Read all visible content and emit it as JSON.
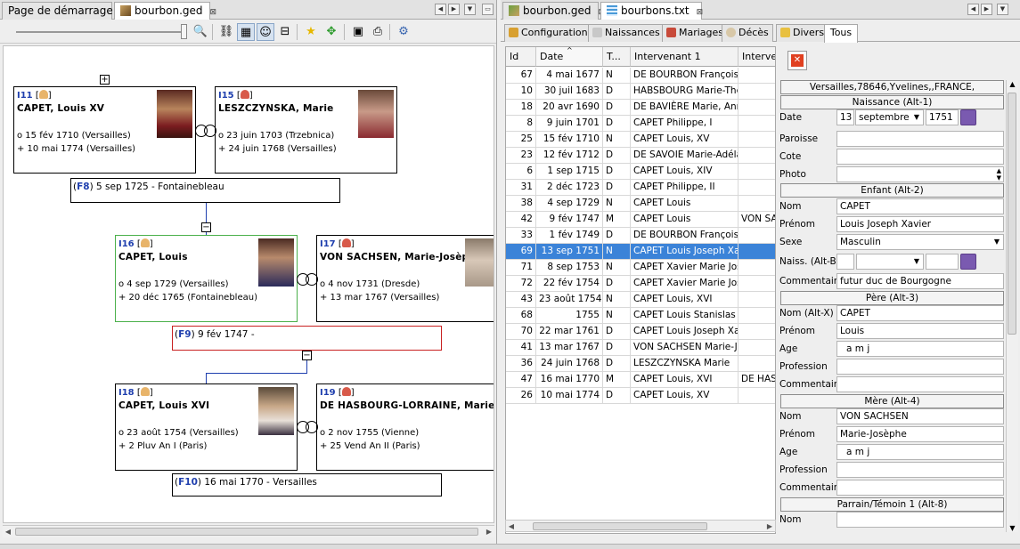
{
  "left": {
    "tabs": [
      {
        "label": "Page de démarrage",
        "close": "⊠"
      },
      {
        "label": "bourbon.ged",
        "close": "⊠"
      }
    ],
    "tree": {
      "individuals": [
        {
          "id": "I11",
          "name": "CAPET, Louis XV",
          "sex": "M",
          "birth": "o 15 fév 1710  (Versailles)",
          "death": "+ 10 mai 1774  (Versailles)"
        },
        {
          "id": "I15",
          "name": "LESZCZYNSKA, Marie",
          "sex": "F",
          "birth": "o 23 juin 1703  (Trzebnica)",
          "death": "+ 24 juin 1768  (Versailles)"
        },
        {
          "id": "I16",
          "name": "CAPET, Louis",
          "sex": "M",
          "birth": "o 4 sep 1729  (Versailles)",
          "death": "+ 20 déc 1765  (Fontainebleau)"
        },
        {
          "id": "I17",
          "name": "VON SACHSEN, Marie-Josèphe",
          "sex": "F",
          "birth": "o 4 nov 1731  (Dresde)",
          "death": "+ 13 mar 1767  (Versailles)"
        },
        {
          "id": "I18",
          "name": "CAPET, Louis XVI",
          "sex": "M",
          "birth": "o 23 août 1754  (Versailles)",
          "death": "+ 2 Pluv An I  (Paris)"
        },
        {
          "id": "I19",
          "name": "DE HASBOURG-LORRAINE, Marie Antoinette",
          "sex": "F",
          "birth": "o 2 nov 1755  (Vienne)",
          "death": "+ 25 Vend An II  (Paris)"
        }
      ],
      "families": [
        {
          "id": "F8",
          "text": ") 5 sep 1725 - Fontainebleau"
        },
        {
          "id": "F9",
          "text": ") 9 fév 1747 -"
        },
        {
          "id": "F10",
          "text": ") 16 mai 1770 - Versailles"
        }
      ],
      "expand_plus": "+",
      "collapse_minus": "−"
    }
  },
  "right": {
    "tabs": [
      {
        "label": "bourbon.ged",
        "close": "⊠"
      },
      {
        "label": "bourbons.txt",
        "close": "⊠"
      }
    ],
    "subtabs": [
      "Configuration",
      "Naissances",
      "Mariages",
      "Décès",
      "Divers",
      "Tous"
    ],
    "table": {
      "columns": [
        "Id",
        "Date",
        "T...",
        "Intervenant 1",
        "Interven"
      ],
      "rows": [
        [
          "67",
          "4 mai 1677",
          "N",
          "DE BOURBON Françoise,",
          ""
        ],
        [
          "10",
          "30 juil 1683",
          "D",
          "HABSBOURG Marie-Thére",
          ""
        ],
        [
          "18",
          "20 avr 1690",
          "D",
          "DE BAVIÈRE Marie, Anne",
          ""
        ],
        [
          "8",
          "9 juin 1701",
          "D",
          "CAPET Philippe, I",
          ""
        ],
        [
          "25",
          "15 fév 1710",
          "N",
          "CAPET Louis, XV",
          ""
        ],
        [
          "23",
          "12 fév 1712",
          "D",
          "DE SAVOIE Marie-Adélaïc",
          ""
        ],
        [
          "6",
          "1 sep 1715",
          "D",
          "CAPET Louis, XIV",
          ""
        ],
        [
          "31",
          "2 déc 1723",
          "D",
          "CAPET Philippe, II",
          ""
        ],
        [
          "38",
          "4 sep 1729",
          "N",
          "CAPET Louis",
          ""
        ],
        [
          "42",
          "9 fév 1747",
          "M",
          "CAPET Louis",
          "VON SAC"
        ],
        [
          "33",
          "1 fév 1749",
          "D",
          "DE BOURBON Françoise,",
          ""
        ],
        [
          "69",
          "13 sep 1751",
          "N",
          "CAPET Louis Joseph Xav",
          ""
        ],
        [
          "71",
          "8 sep 1753",
          "N",
          "CAPET Xavier Marie Jose",
          ""
        ],
        [
          "72",
          "22 fév 1754",
          "D",
          "CAPET Xavier Marie Jose",
          ""
        ],
        [
          "43",
          "23 août 1754",
          "N",
          "CAPET Louis, XVI",
          ""
        ],
        [
          "68",
          "1755",
          "N",
          "CAPET Louis Stanislas Xa",
          ""
        ],
        [
          "70",
          "22 mar 1761",
          "D",
          "CAPET Louis Joseph Xav",
          ""
        ],
        [
          "41",
          "13 mar 1767",
          "D",
          "VON SACHSEN Marie-Jos",
          ""
        ],
        [
          "36",
          "24 juin 1768",
          "D",
          "LESZCZYNSKA Marie",
          ""
        ],
        [
          "47",
          "16 mai 1770",
          "M",
          "CAPET Louis, XVI",
          "DE HASE"
        ],
        [
          "26",
          "10 mai 1774",
          "D",
          "CAPET Louis, XV",
          ""
        ]
      ],
      "selected_index": 11
    },
    "editor": {
      "place": "Versailles,78646,Yvelines,,FRANCE,",
      "sections": {
        "birth": "Naissance  (Alt-1)",
        "child": "Enfant  (Alt-2)",
        "father": "Père  (Alt-3)",
        "mother": "Mère  (Alt-4)",
        "godparent": "Parrain/Témoin 1  (Alt-8)"
      },
      "labels": {
        "date": "Date",
        "paroisse": "Paroisse",
        "cote": "Cote",
        "photo": "Photo",
        "nom": "Nom",
        "prenom": "Prénom",
        "sexe": "Sexe",
        "naiss": "Naiss. (Alt-B)",
        "commentaire": "Commentaire",
        "nom_altx": "Nom (Alt-X)",
        "age": "Age",
        "profession": "Profession"
      },
      "birth_date": {
        "day": "13",
        "month": "septembre",
        "year": "1751"
      },
      "child": {
        "nom": "CAPET",
        "prenom": "Louis Joseph Xavier",
        "sexe": "Masculin",
        "commentaire": "futur duc de Bourgogne"
      },
      "father": {
        "nom": "CAPET",
        "prenom": "Louis",
        "age": "a    m    j"
      },
      "mother": {
        "nom": "VON SACHSEN",
        "prenom": "Marie-Josèphe",
        "age": "a    m    j"
      }
    }
  }
}
